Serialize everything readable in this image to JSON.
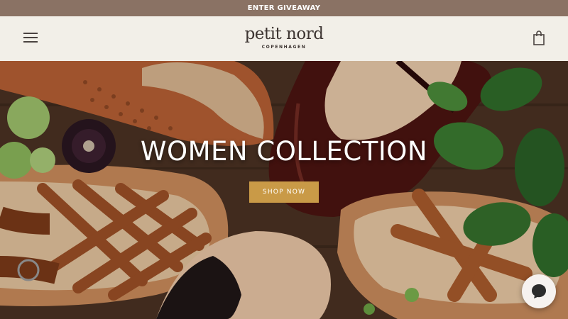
{
  "announcement": {
    "text": "ENTER GIVEAWAY"
  },
  "header": {
    "logo_name": "petit nord",
    "logo_sub": "COPENHAGEN",
    "menu_icon": "hamburger-menu-icon",
    "cart_icon": "shopping-bag-icon"
  },
  "hero": {
    "title": "WOMEN COLLECTION",
    "button_label": "SHOP NOW",
    "button_color": "#c99a47",
    "image_subject": "leather sandals and shoes with flowers and leaves on dark wood"
  },
  "chat": {
    "icon": "chat-bubble-icon"
  },
  "colors": {
    "announcement_bg": "#8a7264",
    "header_bg": "#f2efe8",
    "text_dark": "#3d3532"
  }
}
